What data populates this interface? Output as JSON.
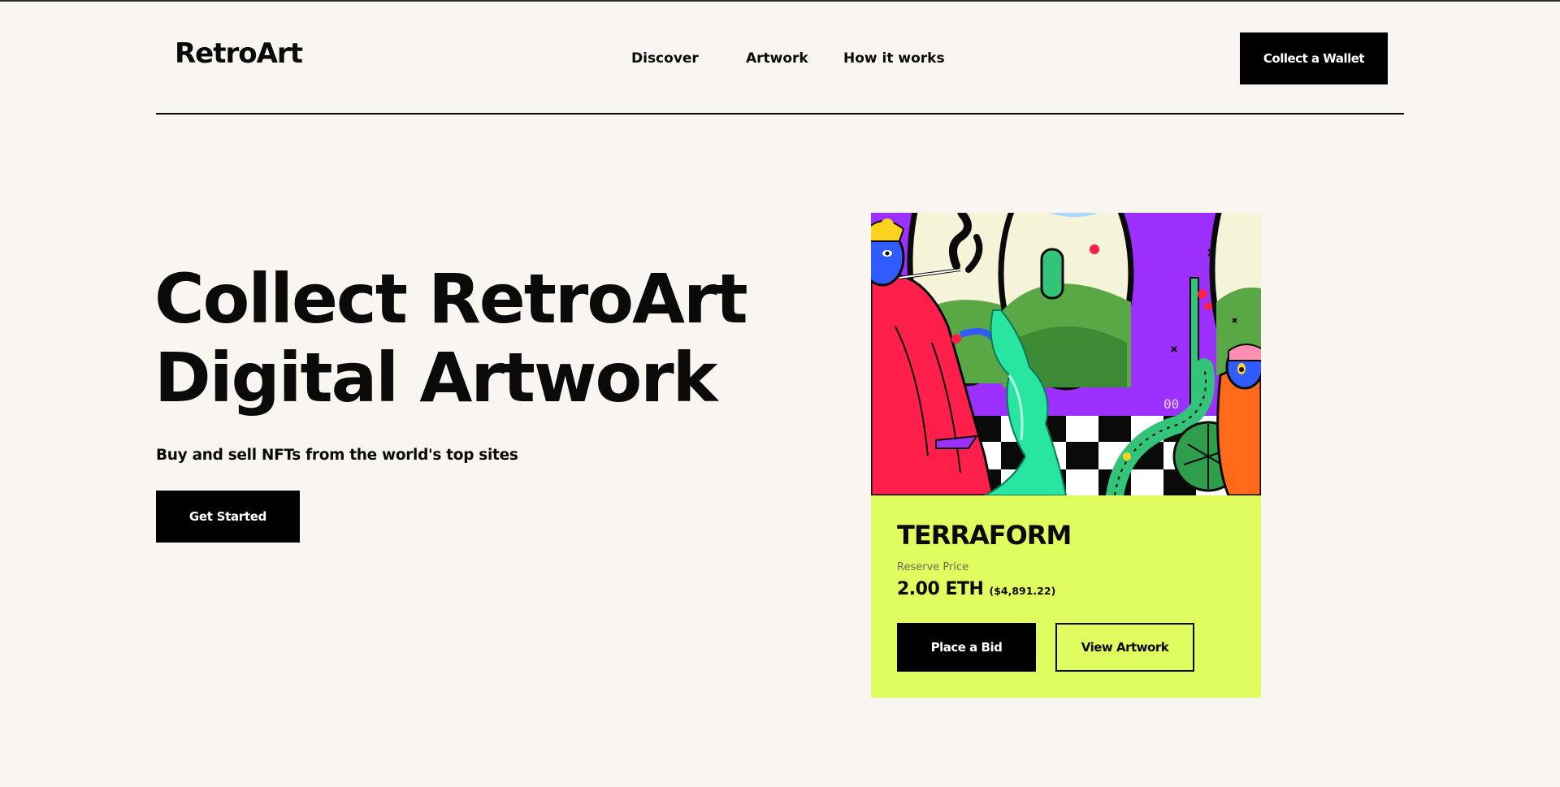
{
  "header": {
    "brand": "RetroArt",
    "nav": [
      {
        "label": "Discover"
      },
      {
        "label": "Artwork"
      },
      {
        "label": "How it works"
      }
    ],
    "cta_label": "Collect a Wallet"
  },
  "hero": {
    "title_line1": "Collect RetroArt",
    "title_line2": "Digital Artwork",
    "subtitle": "Buy and sell NFTs from the world's top sites",
    "cta_label": "Get Started"
  },
  "card": {
    "title": "TERRAFORM",
    "reserve_label": "Reserve Price",
    "price_eth": "2.00 ETH",
    "price_usd": "($4,891.22)",
    "bid_label": "Place a Bid",
    "view_label": "View Artwork",
    "artwork_text": "00"
  },
  "colors": {
    "background": "#f9f6f1",
    "card_accent": "#e0fd60",
    "button": "#000000"
  }
}
